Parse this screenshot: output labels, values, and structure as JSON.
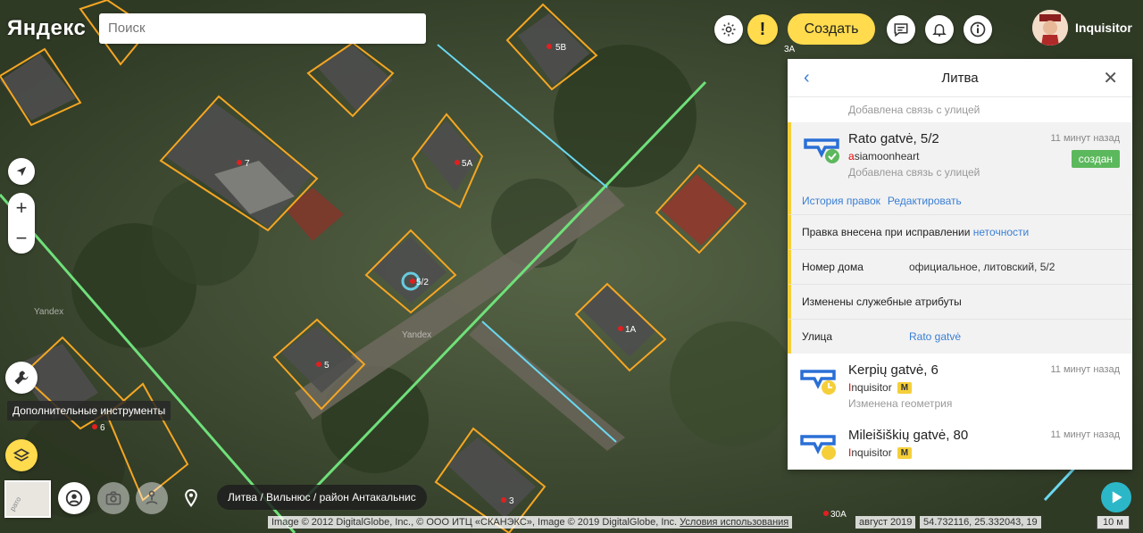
{
  "header": {
    "logo": "Яндекс",
    "search_placeholder": "Поиск",
    "create_label": "Создать",
    "warning_label": "!",
    "user_name": "Inquisitor"
  },
  "map": {
    "labels": [
      "5B",
      "7",
      "5A",
      "5/2",
      "1A",
      "5",
      "6",
      "3",
      "3A",
      "30A"
    ],
    "watermark": "Yandex",
    "copyright": "Image © 2012 DigitalGlobe, Inc., © ООО ИТЦ «СКАНЭКС», Image © 2019 DigitalGlobe, Inc.",
    "terms_link": "Условия использования",
    "date": "август 2019",
    "coords": "54.732116, 25.332043, 19",
    "scale": "10 м",
    "minimap_label": "рато"
  },
  "tools": {
    "tooltip": "Дополнительные инструменты",
    "breadcrumb": "Литва / Вильнюс / район Антакальнис"
  },
  "panel": {
    "title": "Литва",
    "prev_action": "Добавлена связь с улицей",
    "entries": [
      {
        "title": "Rato gatvė, 5/2",
        "time": "11 минут назад",
        "user_first": "a",
        "user_rest": "siamoonheart",
        "action": "Добавлена связь с улицей",
        "badge": "создан"
      },
      {
        "title": "Kerpių gatvė, 6",
        "time": "11 минут назад",
        "user_first": "I",
        "user_rest": "nquisitor",
        "user_badge": "M",
        "action": "Изменена геометрия"
      },
      {
        "title": "Mileišiškių gatvė, 80",
        "time": "11 минут назад",
        "user_first": "I",
        "user_rest": "nquisitor",
        "user_badge": "M"
      }
    ],
    "history_link": "История правок",
    "edit_link": "Редактировать",
    "fix_text": "Правка внесена при исправлении",
    "fix_link": "неточности",
    "house_label": "Номер дома",
    "house_value": "официальное, литовский, 5/2",
    "service_attrs": "Изменены служебные атрибуты",
    "street_label": "Улица",
    "street_value": "Rato gatvė"
  },
  "colors": {
    "accent_yellow": "#ffdb4d",
    "link_blue": "#3a7fd5",
    "building_outline": "#f5a623",
    "green_line": "#6fe07a",
    "cyan_line": "#6ad8f0",
    "badge_green": "#5cb85c"
  }
}
